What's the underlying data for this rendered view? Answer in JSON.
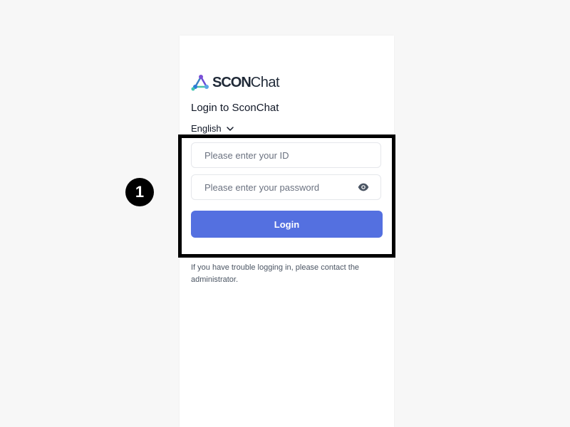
{
  "brand": {
    "name_bold": "SCON",
    "name_light": "Chat",
    "logo_icon": "network-triangle-logo-icon"
  },
  "header": {
    "subtitle": "Login to SconChat"
  },
  "language": {
    "selected": "English",
    "icon": "chevron-down-icon"
  },
  "form": {
    "id_placeholder": "Please enter your ID",
    "id_value": "",
    "password_placeholder": "Please enter your password",
    "password_value": "",
    "password_toggle_icon": "eye-icon",
    "login_label": "Login"
  },
  "help_text": "If you have trouble logging in, please contact the administrator.",
  "annotation": {
    "step_number": "1"
  },
  "colors": {
    "accent": "#5470e0",
    "page_background": "#f7f7f7",
    "panel_background": "#ffffff",
    "highlight_border": "#000000"
  }
}
